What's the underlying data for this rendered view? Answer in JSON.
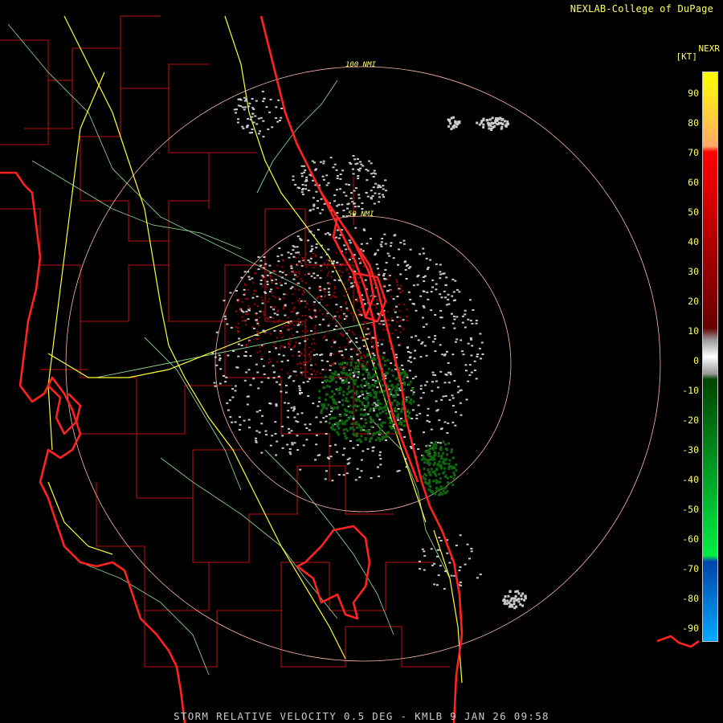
{
  "header": {
    "credit": "NEXLAB-College of DuPage"
  },
  "footer": {
    "product_line": "STORM RELATIVE VELOCITY 0.5 DEG - KMLB 9 JAN 26 09:58"
  },
  "legend": {
    "title": "NEXR",
    "unit": "[KT]",
    "ticks": [
      "90",
      "80",
      "70",
      "60",
      "50",
      "40",
      "30",
      "20",
      "10",
      "0",
      "-10",
      "-20",
      "-30",
      "-40",
      "-50",
      "-60",
      "-70",
      "-80",
      "-90"
    ],
    "colors": {
      "max": "#ffff00",
      "light_orange": "#ffaa66",
      "red": "#ff0000",
      "dark_red": "#660000",
      "zero": "#999999",
      "dark_green": "#004400",
      "green": "#00ee44",
      "dark_blue": "#0044aa",
      "light_blue": "#00aaff"
    }
  },
  "range_rings": {
    "outer_label": "100 NMI",
    "inner_label": "50 NMI"
  },
  "map_colors": {
    "coastline": "#ff2222",
    "county_lines": "#bb1111",
    "highways": "#ffff33",
    "roads": "#88cc88",
    "rings": "#ffbbaa",
    "echo_gray": "#cccccc",
    "echo_red": "#aa0000",
    "echo_green": "#116611"
  }
}
